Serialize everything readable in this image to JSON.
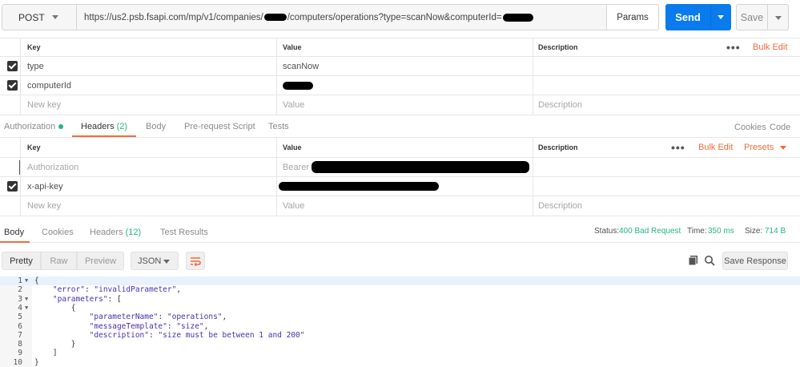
{
  "request": {
    "method": "POST",
    "url_prefix": "https://us2.psb.fsapi.com/mp/v1/companies/",
    "url_middle": "/computers/operations?type=scanNow&computerId=",
    "params_label": "Params",
    "send_label": "Send",
    "save_label": "Save"
  },
  "params_table": {
    "headers": {
      "key": "Key",
      "value": "Value",
      "description": "Description"
    },
    "bulk_edit": "Bulk Edit",
    "rows": [
      {
        "key": "type",
        "value": "scanNow"
      },
      {
        "key": "computerId",
        "value": ""
      }
    ],
    "new_row": {
      "key": "New key",
      "value": "Value",
      "description": "Description"
    }
  },
  "request_tabs": {
    "items": [
      "Authorization",
      "Headers",
      "Body",
      "Pre-request Script",
      "Tests"
    ],
    "headers_count": "(2)",
    "cookies": "Cookies",
    "code": "Code"
  },
  "headers_table": {
    "headers": {
      "key": "Key",
      "value": "Value",
      "description": "Description"
    },
    "bulk_edit": "Bulk Edit",
    "presets": "Presets",
    "rows": [
      {
        "key": "Authorization",
        "value": "Bearer",
        "checked": false
      },
      {
        "key": "x-api-key",
        "value": "",
        "checked": true
      }
    ],
    "new_row": {
      "key": "New key",
      "value": "Value",
      "description": "Description"
    }
  },
  "response_tabs": {
    "items": [
      "Body",
      "Cookies",
      "Headers",
      "Test Results"
    ],
    "headers_count": "(12)"
  },
  "response_status": {
    "status_label": "Status:",
    "status_value": "400 Bad Request",
    "time_label": "Time:",
    "time_value": "350 ms",
    "size_label": "Size:",
    "size_value": "714 B"
  },
  "response_toolbar": {
    "pretty": "Pretty",
    "raw": "Raw",
    "preview": "Preview",
    "format": "JSON",
    "save_response": "Save Response"
  },
  "response_body": {
    "lines": [
      {
        "n": "1",
        "fold": true,
        "key": "",
        "text": "{"
      },
      {
        "n": "2",
        "fold": false,
        "indent": "    ",
        "key": "\"error\"",
        "sep": ": ",
        "value": "\"invalidParameter\"",
        "end": ","
      },
      {
        "n": "3",
        "fold": true,
        "indent": "    ",
        "key": "\"parameters\"",
        "sep": ": ",
        "value": "",
        "end": "["
      },
      {
        "n": "4",
        "fold": true,
        "indent": "        ",
        "key": "",
        "text": "{"
      },
      {
        "n": "5",
        "fold": false,
        "indent": "            ",
        "key": "\"parameterName\"",
        "sep": ": ",
        "value": "\"operations\"",
        "end": ","
      },
      {
        "n": "6",
        "fold": false,
        "indent": "            ",
        "key": "\"messageTemplate\"",
        "sep": ": ",
        "value": "\"size\"",
        "end": ","
      },
      {
        "n": "7",
        "fold": false,
        "indent": "            ",
        "key": "\"description\"",
        "sep": ": ",
        "value": "\"size must be between 1 and 200\"",
        "end": ""
      },
      {
        "n": "8",
        "fold": false,
        "indent": "        ",
        "key": "",
        "text": "}"
      },
      {
        "n": "9",
        "fold": false,
        "indent": "    ",
        "key": "",
        "text": "]"
      },
      {
        "n": "10",
        "fold": false,
        "indent": "",
        "key": "",
        "text": "}"
      }
    ]
  },
  "colors": {
    "accent": "#f26b3a",
    "send": "#097bed",
    "success_green": "#26b47f"
  },
  "icons": [
    "checkbox-checked-icon",
    "caret-down-icon",
    "more-dots-icon",
    "wrap-lines-icon",
    "copy-icon",
    "search-icon",
    "fold-arrow-icon"
  ]
}
